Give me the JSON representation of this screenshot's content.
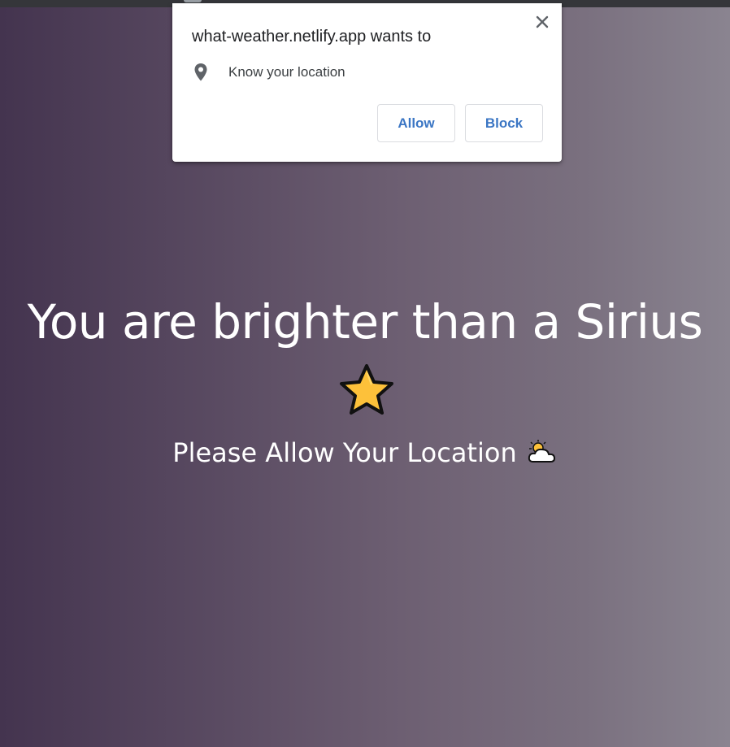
{
  "popup": {
    "title": "what-weather.netlify.app wants to",
    "permission_label": "Know your location",
    "allow_label": "Allow",
    "block_label": "Block",
    "close_icon": "close-icon",
    "permission_icon": "location-pin-icon",
    "button_text_color": "#3b76c4"
  },
  "page": {
    "heading": "You are brighter than a Sirius",
    "heading_icon": "star-emoji-icon",
    "subheading": "Please Allow Your Location",
    "subheading_icon": "sun-behind-cloud-icon",
    "background_gradient": [
      "#44344f",
      "#8a8490"
    ]
  }
}
